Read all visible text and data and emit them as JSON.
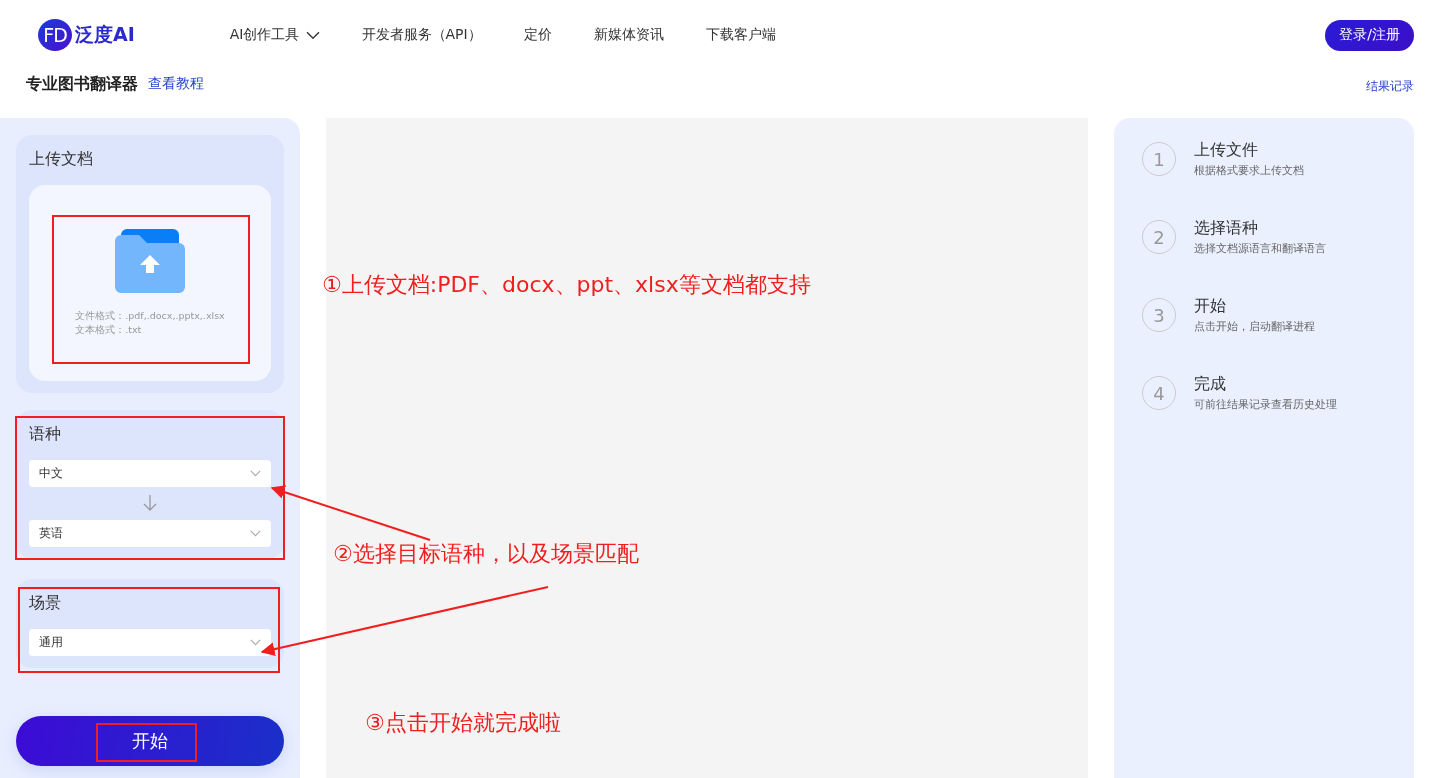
{
  "header": {
    "logo": {
      "mark": "FD",
      "name": "泛度AI"
    },
    "nav": [
      {
        "label": "AI创作工具",
        "dropdown": true
      },
      {
        "label": "开发者服务（API）",
        "dropdown": false
      },
      {
        "label": "定价",
        "dropdown": false
      },
      {
        "label": "新媒体资讯",
        "dropdown": false
      },
      {
        "label": "下载客户端",
        "dropdown": false
      }
    ],
    "login_button": "登录/注册"
  },
  "page_title": "专业图书翻译器",
  "tutorial_link": "查看教程",
  "history_link": "结果记录",
  "upload": {
    "title": "上传文档",
    "formats": [
      "文件格式：.pdf,.docx,.pptx,.xlsx",
      "文本格式：.txt"
    ]
  },
  "language": {
    "title": "语种",
    "source": "中文",
    "target": "英语"
  },
  "scene": {
    "title": "场景",
    "value": "通用"
  },
  "start_button": "开始",
  "steps": [
    {
      "number": "1",
      "title": "上传文件",
      "description": "根据格式要求上传文档"
    },
    {
      "number": "2",
      "title": "选择语种",
      "description": "选择文档源语言和翻译语言"
    },
    {
      "number": "3",
      "title": "开始",
      "description": "点击开始，启动翻译进程"
    },
    {
      "number": "4",
      "title": "完成",
      "description": "可前往结果记录查看历史处理"
    }
  ],
  "annotations": [
    "①上传文档:PDF、docx、ppt、xlsx等文档都支持",
    "②选择目标语种，以及场景匹配",
    "③点击开始就完成啦"
  ]
}
